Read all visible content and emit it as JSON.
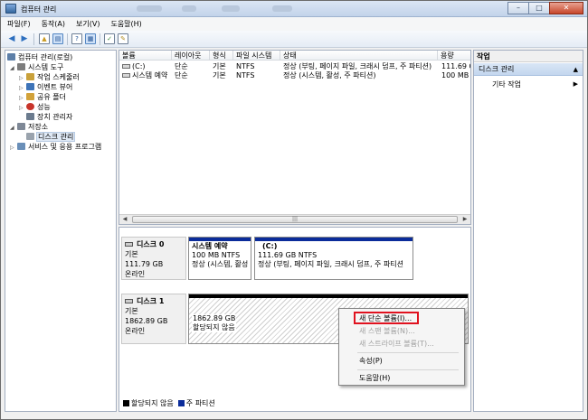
{
  "window": {
    "title": "컴퓨터 관리"
  },
  "menu": [
    "파일(F)",
    "동작(A)",
    "보기(V)",
    "도움말(H)"
  ],
  "tree": [
    {
      "label": "컴퓨터 관리(로컬)",
      "icon": "computer-icon",
      "color": "#5d7fa8"
    },
    {
      "label": "시스템 도구",
      "icon": "tools-icon",
      "color": "#7d7d7d"
    },
    {
      "label": "작업 스케줄러",
      "icon": "clock-icon",
      "color": "#c9a13b"
    },
    {
      "label": "이벤트 뷰어",
      "icon": "event-viewer-icon",
      "color": "#3e74b8"
    },
    {
      "label": "공유 폴더",
      "icon": "shared-folder-icon",
      "color": "#d2a23a"
    },
    {
      "label": "성능",
      "icon": "performance-icon",
      "color": "#c8342a"
    },
    {
      "label": "장치 관리자",
      "icon": "device-manager-icon",
      "color": "#6b7b8e"
    },
    {
      "label": "저장소",
      "icon": "storage-icon",
      "color": "#7e8896"
    },
    {
      "label": "디스크 관리",
      "icon": "disk-management-icon",
      "color": "#9aa3ad"
    },
    {
      "label": "서비스 및 응용 프로그램",
      "icon": "services-icon",
      "color": "#6a8fb8"
    }
  ],
  "volume_table": {
    "columns": [
      "볼륨",
      "레이아웃",
      "형식",
      "파일 시스템",
      "상태",
      "용량"
    ],
    "rows": [
      {
        "volume": "(C:)",
        "layout": "단순",
        "type": "기본",
        "fs": "NTFS",
        "status": "정상 (부팅, 페이지 파일, 크래시 덤프, 주 파티션)",
        "capacity": "111.69 G"
      },
      {
        "volume": "시스템 예약",
        "layout": "단순",
        "type": "기본",
        "fs": "NTFS",
        "status": "정상 (시스템, 활성, 주 파티션)",
        "capacity": "100 MB"
      }
    ]
  },
  "disks": [
    {
      "name": "디스크 0",
      "type": "기본",
      "size": "111.79 GB",
      "state": "온라인",
      "partitions": [
        {
          "title": "시스템 예약",
          "line1": "100 MB NTFS",
          "line2": "정상 (시스템, 활성"
        },
        {
          "title": "(C:)",
          "line1": "111.69 GB NTFS",
          "line2": "정상 (부팅, 페이지 파일, 크래시 덤프, 주 파티션"
        }
      ]
    },
    {
      "name": "디스크 1",
      "type": "기본",
      "size": "1862.89 GB",
      "state": "온라인",
      "partitions": [
        {
          "title": "",
          "line1": "1862.89 GB",
          "line2": "할당되지 않음"
        }
      ]
    }
  ],
  "legend": [
    {
      "label": "할당되지 않음",
      "color": "#000000"
    },
    {
      "label": "주 파티션",
      "color": "#0b2c9a"
    }
  ],
  "context_menu": {
    "items": [
      {
        "label": "새 단순 볼륨(I)...",
        "enabled": true
      },
      {
        "label": "새 스팬 볼륨(N)...",
        "enabled": false
      },
      {
        "label": "새 스트라이프 볼륨(T)...",
        "enabled": false
      },
      {
        "label": "속성(P)",
        "enabled": true
      },
      {
        "label": "도움말(H)",
        "enabled": true
      }
    ],
    "highlight_color": "#e0121f"
  },
  "actions": {
    "header": "작업",
    "group": "디스크 관리",
    "item": "기타 작업"
  }
}
